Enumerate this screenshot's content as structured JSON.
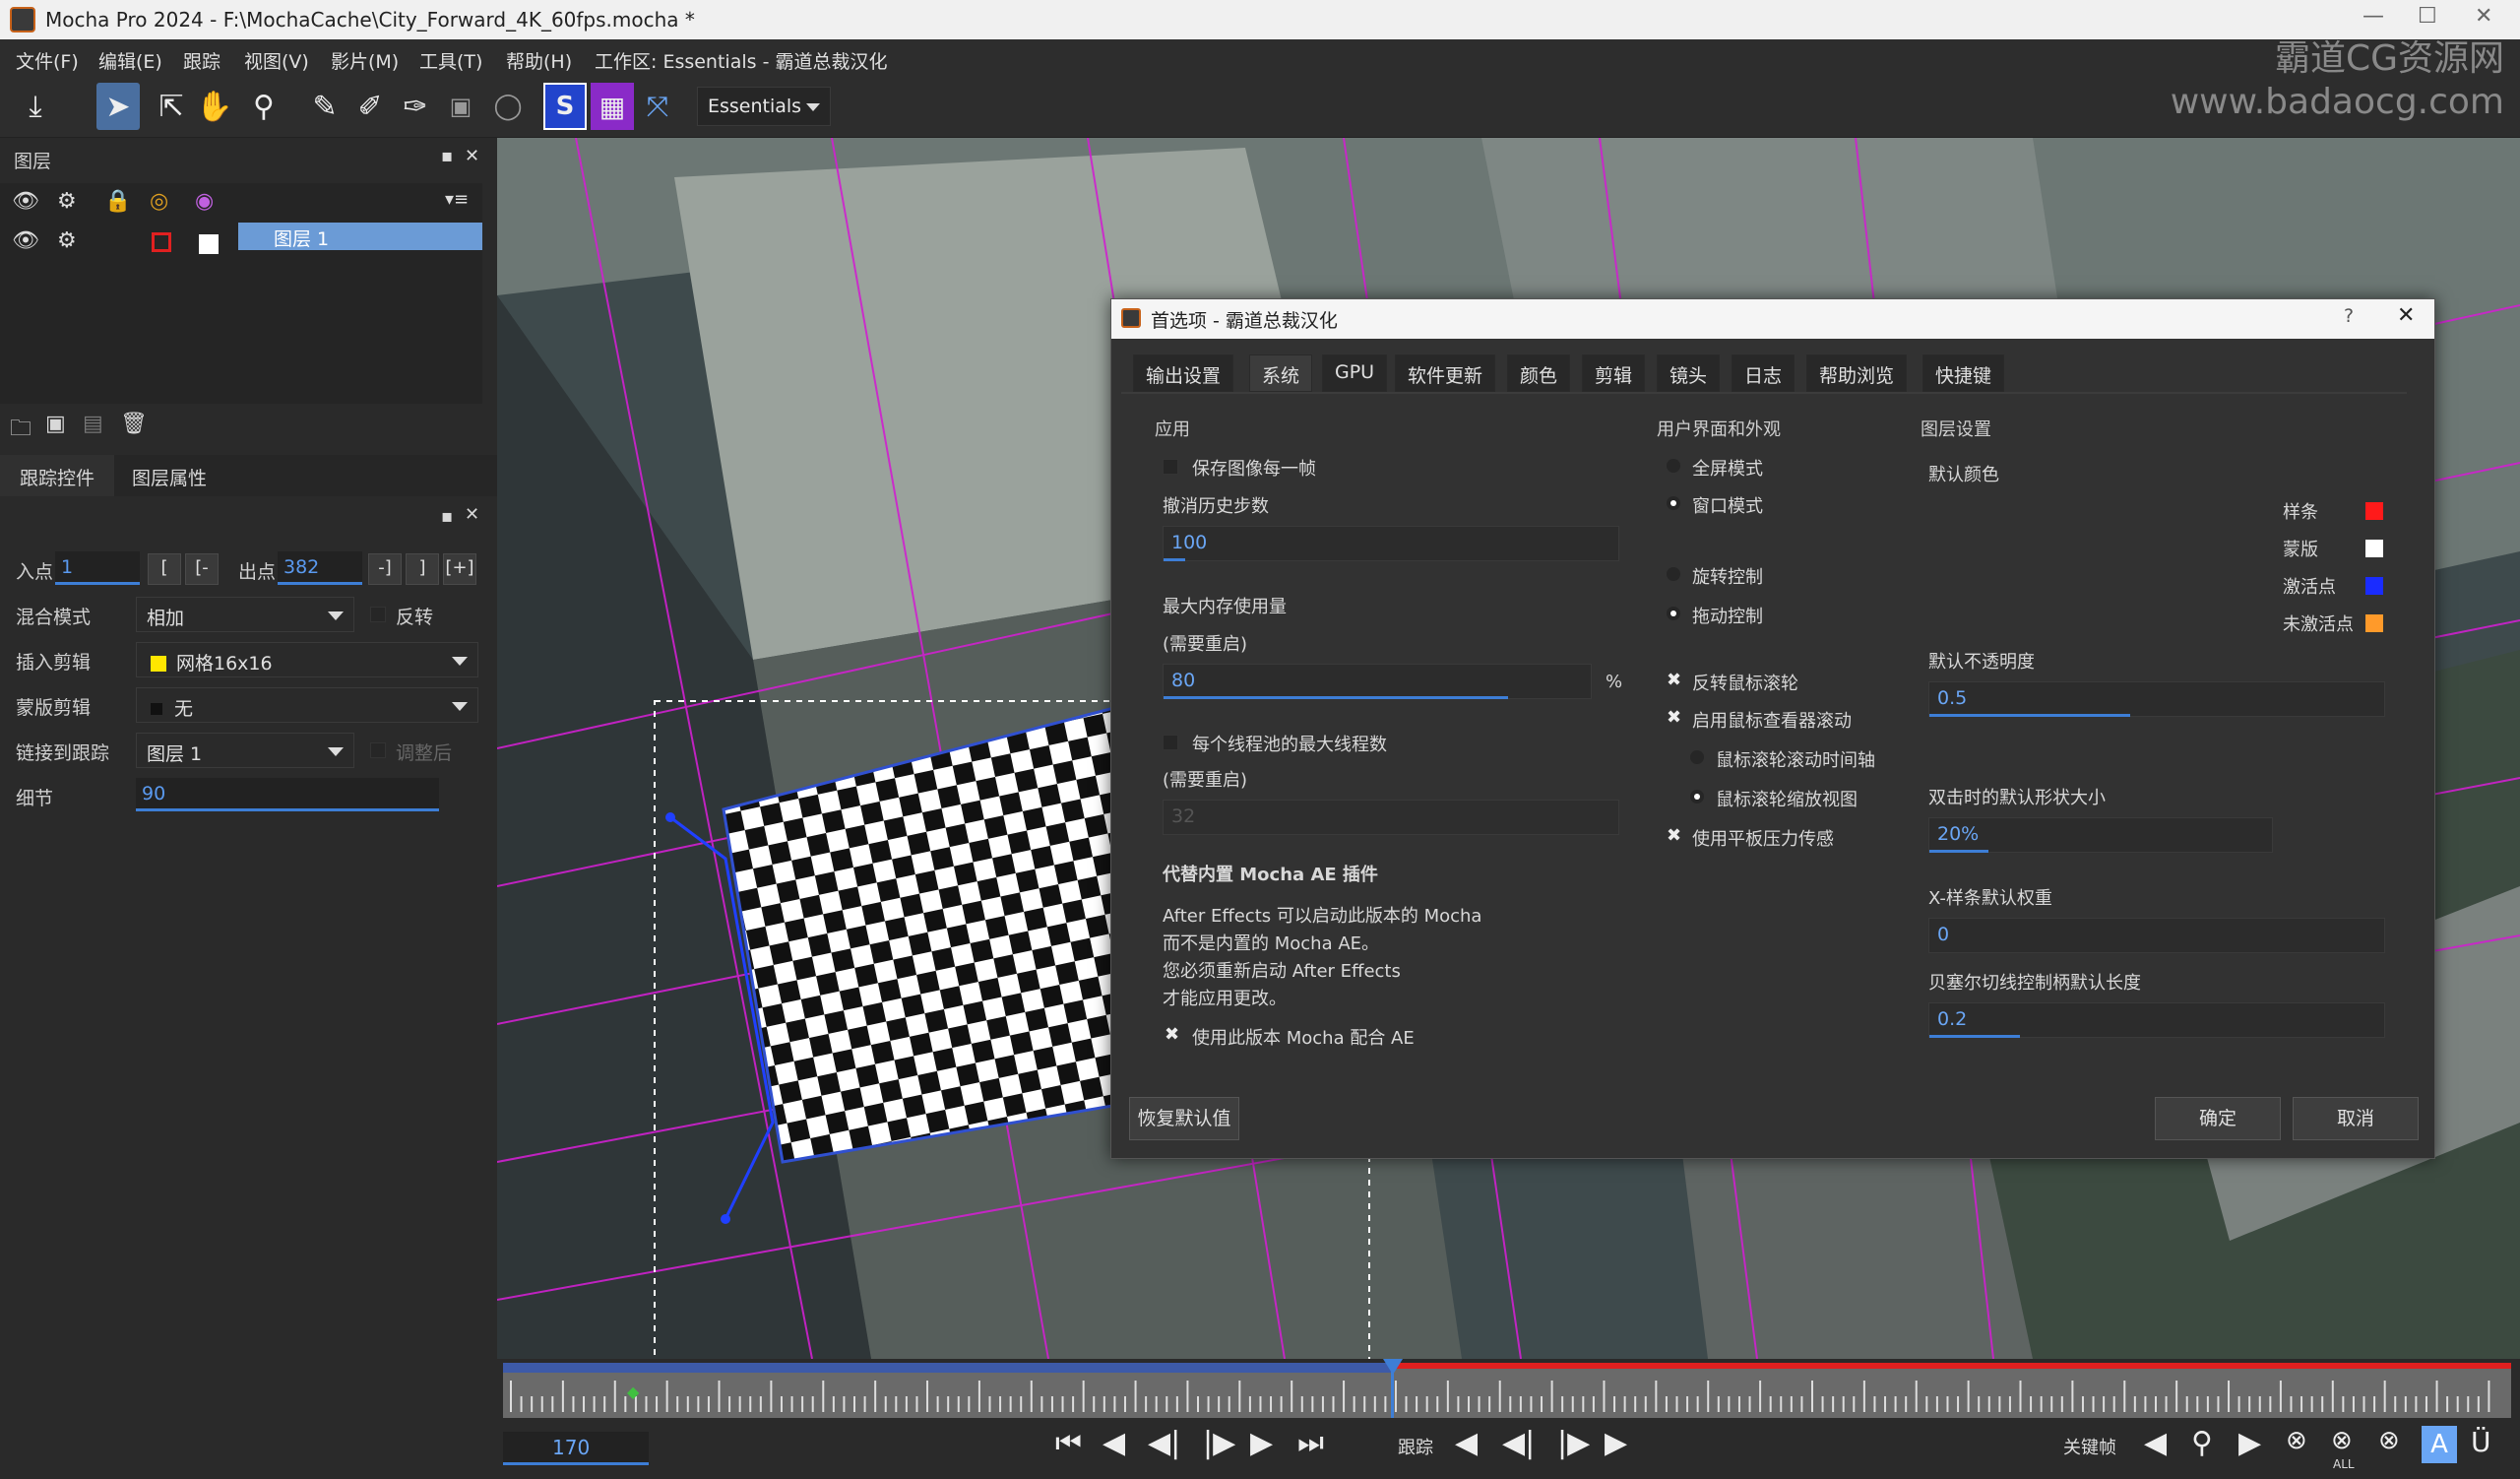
{
  "window": {
    "title": "Mocha Pro 2024 - F:\\MochaCache\\City_Forward_4K_60fps.mocha *"
  },
  "menu": [
    "文件(F)",
    "编辑(E)",
    "跟踪",
    "视图(V)",
    "影片(M)",
    "工具(T)",
    "帮助(H)"
  ],
  "workspace_label": "工作区: Essentials - 霸道总裁汉化",
  "workspace_select": "Essentials",
  "watermark": {
    "line1": "霸道CG资源网",
    "line2": "www.badaocg.com"
  },
  "layers_panel": {
    "title": "图层",
    "layer_name": "图层 1"
  },
  "params_tabs": [
    "跟踪控件",
    "图层属性"
  ],
  "params": {
    "in_label": "入点",
    "in_value": "1",
    "out_label": "出点",
    "out_value": "382",
    "blend_label": "混合模式",
    "blend_value": "相加",
    "invert_label": "反转",
    "insert_label": "插入剪辑",
    "insert_value": "网格16x16",
    "matte_label": "蒙版剪辑",
    "matte_value": "无",
    "link_label": "链接到跟踪",
    "link_value": "图层 1",
    "adjust_label": "调整后",
    "detail_label": "细节",
    "detail_value": "90"
  },
  "dialog": {
    "title": "首选项 - 霸道总裁汉化",
    "help": "?",
    "tabs": [
      "输出设置",
      "系统",
      "GPU",
      "软件更新",
      "颜色",
      "剪辑",
      "镜头",
      "日志",
      "帮助浏览",
      "快捷键"
    ],
    "active_tab": 1,
    "app": {
      "section": "应用",
      "save_each_frame": "保存图像每一帧",
      "undo_steps_label": "撤消历史步数",
      "undo_steps": "100",
      "max_mem_label": "最大内存使用量",
      "restart1": "(需要重启)",
      "max_mem": "80",
      "max_mem_unit": "%",
      "max_threads_label": "每个线程池的最大线程数",
      "restart2": "(需要重启)",
      "max_threads": "32",
      "ae_heading": "代替内置 Mocha AE 插件",
      "ae_desc1": "After Effects 可以启动此版本的 Mocha",
      "ae_desc2": "而不是内置的 Mocha AE。",
      "ae_desc3": "您必须重新启动 After Effects",
      "ae_desc4": "才能应用更改。",
      "use_this_mocha": "使用此版本 Mocha 配合 AE"
    },
    "ui": {
      "section": "用户界面和外观",
      "fullscreen": "全屏模式",
      "windowed": "窗口模式",
      "rotate_ctrl": "旋转控制",
      "drag_ctrl": "拖动控制",
      "invert_wheel": "反转鼠标滚轮",
      "enable_wheel_scroll": "启用鼠标查看器滚动",
      "wheel_timeline": "鼠标滚轮滚动时间轴",
      "wheel_zoom": "鼠标滚轮缩放视图",
      "tablet_pressure": "使用平板压力传感"
    },
    "layer": {
      "section": "图层设置",
      "default_color": "默认颜色",
      "spline": "样条",
      "spline_color": "#ff1a1a",
      "matte": "蒙版",
      "matte_color": "#ffffff",
      "active_pt": "激活点",
      "active_color": "#1a2cff",
      "inactive_pt": "未激活点",
      "inactive_color": "#ff9a2a",
      "opacity_label": "默认不透明度",
      "opacity": "0.5",
      "shape_size_label": "双击时的默认形状大小",
      "shape_size": "20%",
      "xspline_label": "X-样条默认权重",
      "xspline": "0",
      "bezier_label": "贝塞尔切线控制柄默认长度",
      "bezier": "0.2"
    },
    "restore_defaults": "恢复默认值",
    "ok": "确定",
    "cancel": "取消"
  },
  "timeline": {
    "frame": "170",
    "track_label": "跟踪",
    "keyframe_label": "关键帧",
    "all_label": "ALL"
  }
}
